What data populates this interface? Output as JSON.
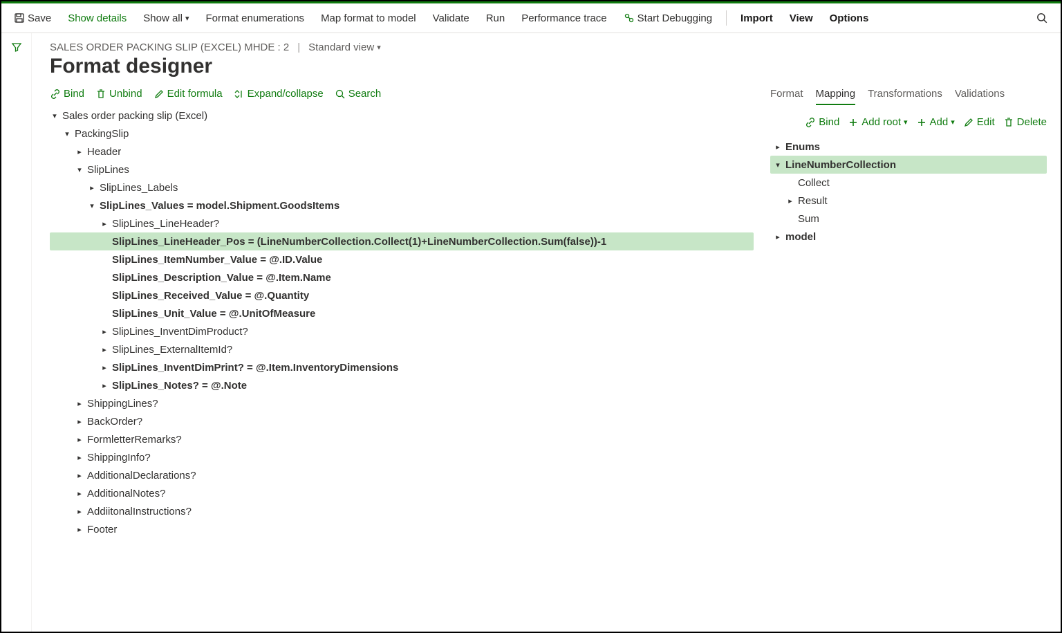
{
  "toolbar": {
    "save": "Save",
    "show_details": "Show details",
    "show_all": "Show all",
    "format_enum": "Format enumerations",
    "map_format": "Map format to model",
    "validate": "Validate",
    "run": "Run",
    "perf_trace": "Performance trace",
    "start_debug": "Start Debugging",
    "import": "Import",
    "view": "View",
    "options": "Options"
  },
  "breadcrumb": {
    "title": "SALES ORDER PACKING SLIP (EXCEL) MHDE : 2",
    "view": "Standard view"
  },
  "page_title": "Format designer",
  "left_actions": {
    "bind": "Bind",
    "unbind": "Unbind",
    "edit_formula": "Edit formula",
    "expand": "Expand/collapse",
    "search": "Search"
  },
  "right_tabs": {
    "format": "Format",
    "mapping": "Mapping",
    "transformations": "Transformations",
    "validations": "Validations"
  },
  "right_actions": {
    "bind": "Bind",
    "add_root": "Add root",
    "add": "Add",
    "edit": "Edit",
    "delete": "Delete"
  },
  "left_tree": {
    "root": "Sales order packing slip (Excel)",
    "packing_slip": "PackingSlip",
    "header": "Header",
    "slip_lines": "SlipLines",
    "slip_lines_labels": "SlipLines_Labels",
    "slip_lines_values_k": "SlipLines_Values",
    "slip_lines_values_v": "model.Shipment.GoodsItems",
    "line_header": "SlipLines_LineHeader?",
    "line_header_pos_k": "SlipLines_LineHeader_Pos",
    "line_header_pos_v": "(LineNumberCollection.Collect(1)+LineNumberCollection.Sum(false))-1",
    "item_number_k": "SlipLines_ItemNumber_Value",
    "item_number_v": "@.ID.Value",
    "description_k": "SlipLines_Description_Value",
    "description_v": "@.Item.Name",
    "received_k": "SlipLines_Received_Value",
    "received_v": "@.Quantity",
    "unit_k": "SlipLines_Unit_Value",
    "unit_v": "@.UnitOfMeasure",
    "invent_dim_product": "SlipLines_InventDimProduct?",
    "external_item": "SlipLines_ExternalItemId?",
    "invent_dim_print_k": "SlipLines_InventDimPrint?",
    "invent_dim_print_v": "@.Item.InventoryDimensions",
    "notes_k": "SlipLines_Notes?",
    "notes_v": "@.Note",
    "shipping_lines": "ShippingLines?",
    "back_order": "BackOrder?",
    "formletter": "FormletterRemarks?",
    "shipping_info": "ShippingInfo?",
    "add_decl": "AdditionalDeclarations?",
    "add_notes": "AdditionalNotes?",
    "add_instr": "AddiitonalInstructions?",
    "footer": "Footer"
  },
  "right_tree": {
    "enums": "Enums",
    "lnc": "LineNumberCollection",
    "collect": "Collect",
    "result": "Result",
    "sum": "Sum",
    "model": "model"
  }
}
